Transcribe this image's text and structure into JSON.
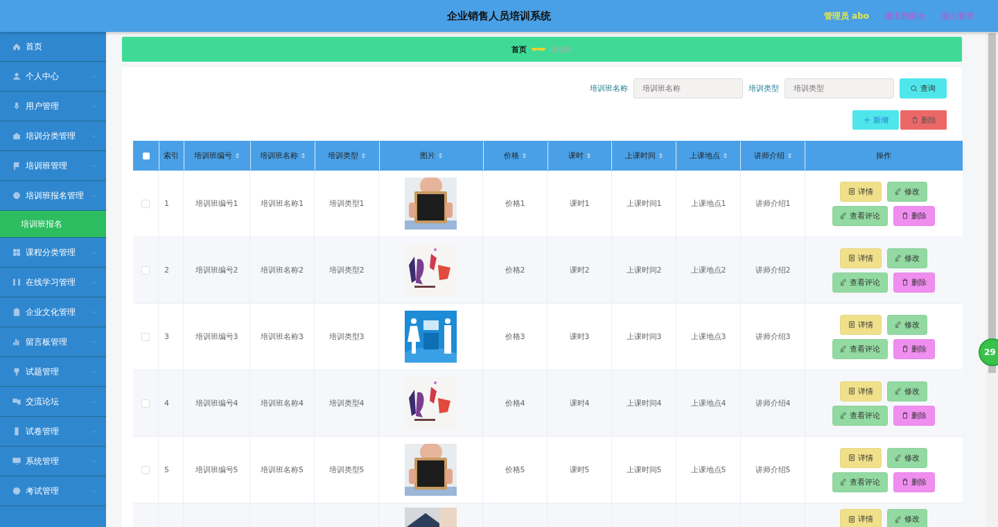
{
  "header": {
    "title": "企业销售人员培训系统",
    "user": "管理员 abo",
    "links": [
      "退出到前台",
      "退出登录"
    ]
  },
  "sidebar": {
    "items": [
      {
        "label": "首页",
        "kind": "link"
      },
      {
        "label": "个人中心",
        "kind": "menu",
        "expanded": false
      },
      {
        "label": "用户管理",
        "kind": "menu",
        "expanded": false
      },
      {
        "label": "培训分类管理",
        "kind": "menu",
        "expanded": false
      },
      {
        "label": "培训班管理",
        "kind": "menu",
        "expanded": false
      },
      {
        "label": "培训班报名管理",
        "kind": "menu",
        "expanded": true,
        "children": [
          {
            "label": "培训班报名",
            "selected": true
          }
        ]
      },
      {
        "label": "课程分类管理",
        "kind": "menu",
        "expanded": false
      },
      {
        "label": "在线学习管理",
        "kind": "menu",
        "expanded": false
      },
      {
        "label": "企业文化管理",
        "kind": "menu",
        "expanded": false
      },
      {
        "label": "留言板管理",
        "kind": "menu",
        "expanded": false
      },
      {
        "label": "试题管理",
        "kind": "menu",
        "expanded": false
      },
      {
        "label": "交流论坛",
        "kind": "menu",
        "expanded": false
      },
      {
        "label": "试卷管理",
        "kind": "menu",
        "expanded": false
      },
      {
        "label": "系统管理",
        "kind": "menu",
        "expanded": false
      },
      {
        "label": "考试管理",
        "kind": "menu",
        "expanded": false
      }
    ]
  },
  "breadcrumb": [
    "首页",
    "培训班"
  ],
  "search": {
    "fields": [
      {
        "label": "培训班名称",
        "placeholder": "培训班名称"
      },
      {
        "label": "培训类型",
        "placeholder": "培训类型"
      }
    ],
    "button": "查询"
  },
  "toolbar": [
    {
      "label": "新增",
      "kind": "add"
    },
    {
      "label": "删除",
      "kind": "delete"
    }
  ],
  "table": {
    "select_all_checked": false,
    "columns": [
      {
        "label": "索引",
        "sortable": false
      },
      {
        "label": "培训班编号",
        "sortable": true
      },
      {
        "label": "培训班名称",
        "sortable": true
      },
      {
        "label": "培训类型",
        "sortable": true
      },
      {
        "label": "图片",
        "sortable": true
      },
      {
        "label": "价格",
        "sortable": true
      },
      {
        "label": "课时",
        "sortable": true
      },
      {
        "label": "上课时间",
        "sortable": true
      },
      {
        "label": "上课地点",
        "sortable": true
      },
      {
        "label": "讲师介绍",
        "sortable": true
      },
      {
        "label": "操作",
        "sortable": false
      }
    ],
    "rows": [
      {
        "checked": false,
        "cells": [
          "1",
          "培训班编号1",
          "培训班名称1",
          "培训类型1",
          "价格1",
          "课时1",
          "上课时间1",
          "上课地点1",
          "讲师介绍1"
        ],
        "actions": [
          {
            "label": "详情",
            "kind": "detail"
          },
          {
            "label": "修改",
            "kind": "edit"
          },
          {
            "label": "查看评论",
            "kind": "comment"
          },
          {
            "label": "删除",
            "kind": "delete"
          }
        ]
      },
      {
        "checked": false,
        "cells": [
          "2",
          "培训班编号2",
          "培训班名称2",
          "培训类型2",
          "价格2",
          "课时2",
          "上课时间2",
          "上课地点2",
          "讲师介绍2"
        ],
        "actions": [
          {
            "label": "详情",
            "kind": "detail"
          },
          {
            "label": "修改",
            "kind": "edit"
          },
          {
            "label": "查看评论",
            "kind": "comment"
          },
          {
            "label": "删除",
            "kind": "delete"
          }
        ]
      },
      {
        "checked": false,
        "cells": [
          "3",
          "培训班编号3",
          "培训班名称3",
          "培训类型3",
          "价格3",
          "课时3",
          "上课时间3",
          "上课地点3",
          "讲师介绍3"
        ],
        "actions": [
          {
            "label": "详情",
            "kind": "detail"
          },
          {
            "label": "修改",
            "kind": "edit"
          },
          {
            "label": "查看评论",
            "kind": "comment"
          },
          {
            "label": "删除",
            "kind": "delete"
          }
        ]
      },
      {
        "checked": false,
        "cells": [
          "4",
          "培训班编号4",
          "培训班名称4",
          "培训类型4",
          "价格4",
          "课时4",
          "上课时间4",
          "上课地点4",
          "讲师介绍4"
        ],
        "actions": [
          {
            "label": "详情",
            "kind": "detail"
          },
          {
            "label": "修改",
            "kind": "edit"
          },
          {
            "label": "查看评论",
            "kind": "comment"
          },
          {
            "label": "删除",
            "kind": "delete"
          }
        ]
      },
      {
        "checked": false,
        "cells": [
          "5",
          "培训班编号5",
          "培训班名称5",
          "培训类型5",
          "价格5",
          "课时5",
          "上课时间5",
          "上课地点5",
          "讲师介绍5"
        ],
        "actions": [
          {
            "label": "详情",
            "kind": "detail"
          },
          {
            "label": "修改",
            "kind": "edit"
          },
          {
            "label": "查看评论",
            "kind": "comment"
          },
          {
            "label": "删除",
            "kind": "delete"
          }
        ]
      },
      {
        "actions": [
          {
            "label": "详情",
            "kind": "detail"
          },
          {
            "label": "修改",
            "kind": "edit"
          }
        ]
      }
    ]
  },
  "badge": "29"
}
